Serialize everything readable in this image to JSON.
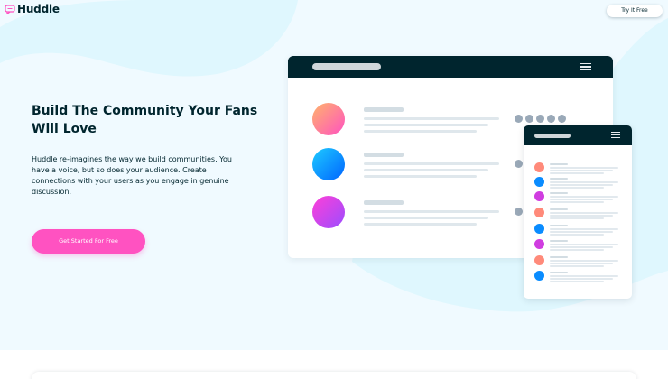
{
  "brand": {
    "name": "Huddle",
    "logo_icon": "chat-bubble-icon",
    "colors": {
      "dark_cyan": "#00252e",
      "pink": "#ff52c1",
      "light_bg": "#f0faff",
      "blob": "#dff7fe"
    }
  },
  "header": {
    "try_button_label": "Try It Free"
  },
  "hero": {
    "title": "Build The Community Your Fans Will Love",
    "description": "Huddle re-imagines the way we build communities. You have a voice, but so does your audience. Create connections with your users as you engage in genuine discussion.",
    "cta_label": "Get Started For Free"
  },
  "illustration": {
    "desktop_mockup": {
      "menu_icon": "hamburger-icon",
      "rows": [
        {
          "avatar_gradient": [
            "#ffb36b",
            "#ff52c1"
          ],
          "online_dots": 5
        },
        {
          "avatar_gradient": [
            "#1ecbff",
            "#0064ff"
          ],
          "online_dots": 1
        },
        {
          "avatar_gradient": [
            "#ff3fd8",
            "#9b4dff"
          ],
          "online_dots": 1
        }
      ]
    },
    "mobile_mockup": {
      "menu_icon": "hamburger-icon",
      "avatar_colors": [
        "#ff8a7a",
        "#0a8cff",
        "#d03de0",
        "#ff8a7a",
        "#0a8cff",
        "#d03de0",
        "#ff8a7a",
        "#0a8cff"
      ]
    }
  }
}
